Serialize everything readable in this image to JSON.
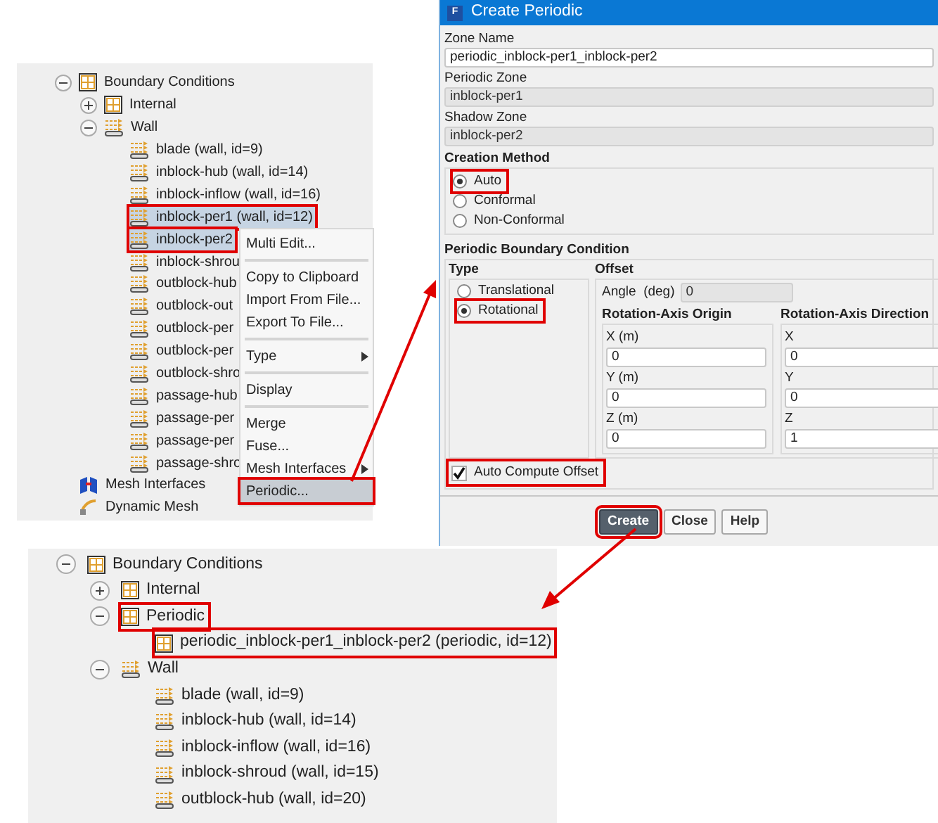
{
  "top_tree": {
    "items": [
      {
        "label": "Boundary Conditions",
        "kind": "grid",
        "expanded": true,
        "children": [
          {
            "label": "Internal",
            "kind": "grid",
            "expanded": false
          },
          {
            "label": "Wall",
            "kind": "wall",
            "expanded": true,
            "children": [
              {
                "label": "blade (wall, id=9)",
                "kind": "wall",
                "selected": false,
                "highlighted": false
              },
              {
                "label": "inblock-hub (wall, id=14)",
                "kind": "wall",
                "selected": false,
                "highlighted": false
              },
              {
                "label": "inblock-inflow (wall, id=16)",
                "kind": "wall",
                "selected": false,
                "highlighted": false
              },
              {
                "label": "inblock-per1 (wall, id=12)",
                "kind": "wall",
                "selected": true,
                "highlighted": true
              },
              {
                "label": "inblock-per2",
                "kind": "wall",
                "selected": true,
                "highlighted": true
              },
              {
                "label": "inblock-shrou",
                "kind": "wall",
                "selected": false,
                "highlighted": false
              },
              {
                "label": "outblock-hub",
                "kind": "wall",
                "selected": false,
                "highlighted": false
              },
              {
                "label": "outblock-out",
                "kind": "wall",
                "selected": false,
                "highlighted": false
              },
              {
                "label": "outblock-per",
                "kind": "wall",
                "selected": false,
                "highlighted": false
              },
              {
                "label": "outblock-per",
                "kind": "wall",
                "selected": false,
                "highlighted": false
              },
              {
                "label": "outblock-shro",
                "kind": "wall",
                "selected": false,
                "highlighted": false
              },
              {
                "label": "passage-hub",
                "kind": "wall",
                "selected": false,
                "highlighted": false
              },
              {
                "label": "passage-per",
                "kind": "wall",
                "selected": false,
                "highlighted": false
              },
              {
                "label": "passage-per",
                "kind": "wall",
                "selected": false,
                "highlighted": false
              },
              {
                "label": "passage-shro",
                "kind": "wall",
                "selected": false,
                "highlighted": false
              }
            ]
          }
        ]
      },
      {
        "label": "Mesh Interfaces",
        "kind": "interface"
      },
      {
        "label": "Dynamic Mesh",
        "kind": "dynamic"
      }
    ]
  },
  "context_menu": {
    "groups": [
      [
        {
          "label": "Multi Edit...",
          "submenu": false,
          "selected": false,
          "highlighted": false
        }
      ],
      [
        {
          "label": "Copy to Clipboard",
          "submenu": false,
          "selected": false,
          "highlighted": false
        },
        {
          "label": "Import From File...",
          "submenu": false,
          "selected": false,
          "highlighted": false
        },
        {
          "label": "Export To File...",
          "submenu": false,
          "selected": false,
          "highlighted": false
        }
      ],
      [
        {
          "label": "Type",
          "submenu": true,
          "selected": false,
          "highlighted": false
        }
      ],
      [
        {
          "label": "Display",
          "submenu": false,
          "selected": false,
          "highlighted": false
        }
      ],
      [
        {
          "label": "Merge",
          "submenu": false,
          "selected": false,
          "highlighted": false
        },
        {
          "label": "Fuse...",
          "submenu": false,
          "selected": false,
          "highlighted": false
        },
        {
          "label": "Mesh Interfaces",
          "submenu": true,
          "selected": false,
          "highlighted": false
        },
        {
          "label": "Periodic...",
          "submenu": false,
          "selected": true,
          "highlighted": true
        }
      ]
    ]
  },
  "dialog": {
    "title_icon": "F",
    "title": "Create Periodic",
    "fields": [
      {
        "label": "Zone Name",
        "value": "periodic_inblock-per1_inblock-per2",
        "disabled": false
      },
      {
        "label": "Periodic Zone",
        "value": "inblock-per1",
        "disabled": true
      },
      {
        "label": "Shadow Zone",
        "value": "inblock-per2",
        "disabled": true
      }
    ],
    "creation_method": {
      "label": "Creation Method",
      "options": [
        {
          "label": "Auto",
          "selected": true,
          "highlighted": true
        },
        {
          "label": "Conformal",
          "selected": false,
          "highlighted": false
        },
        {
          "label": "Non-Conformal",
          "selected": false,
          "highlighted": false
        }
      ]
    },
    "periodic_boundary_condition": {
      "label": "Periodic Boundary Condition",
      "type": {
        "label": "Type",
        "options": [
          {
            "label": "Translational",
            "selected": false,
            "highlighted": false
          },
          {
            "label": "Rotational",
            "selected": true,
            "highlighted": true
          }
        ]
      },
      "offset": {
        "label": "Offset",
        "angle": {
          "label": "Angle  (deg)",
          "value": "0",
          "disabled": true
        },
        "axis_groups": [
          {
            "label": "Rotation-Axis Origin",
            "fields": [
              {
                "label": "X (m)",
                "value": "0"
              },
              {
                "label": "Y (m)",
                "value": "0"
              },
              {
                "label": "Z (m)",
                "value": "0"
              }
            ]
          },
          {
            "label": "Rotation-Axis Direction",
            "fields": [
              {
                "label": "X",
                "value": "0"
              },
              {
                "label": "Y",
                "value": "0"
              },
              {
                "label": "Z",
                "value": "1"
              }
            ]
          }
        ]
      },
      "auto_compute_offset": {
        "label": "Auto Compute Offset",
        "checked": true,
        "highlighted": true
      }
    },
    "buttons": [
      {
        "label": "Create",
        "kind": "primary",
        "highlighted": true
      },
      {
        "label": "Close",
        "kind": "normal",
        "highlighted": false
      },
      {
        "label": "Help",
        "kind": "normal",
        "highlighted": false
      }
    ]
  },
  "bottom_tree": {
    "items": [
      {
        "label": "Boundary Conditions",
        "kind": "grid",
        "expanded": true,
        "children": [
          {
            "label": "Internal",
            "kind": "grid",
            "expanded": false,
            "highlighted": false
          },
          {
            "label": "Periodic",
            "kind": "grid",
            "expanded": true,
            "highlighted": true,
            "children": [
              {
                "label": "periodic_inblock-per1_inblock-per2 (periodic, id=12)",
                "kind": "grid",
                "selected": false,
                "highlighted": true
              }
            ]
          },
          {
            "label": "Wall",
            "kind": "wall",
            "expanded": true,
            "highlighted": false,
            "children": [
              {
                "label": "blade (wall, id=9)",
                "kind": "wall",
                "selected": false,
                "highlighted": false
              },
              {
                "label": "inblock-hub (wall, id=14)",
                "kind": "wall",
                "selected": false,
                "highlighted": false
              },
              {
                "label": "inblock-inflow (wall, id=16)",
                "kind": "wall",
                "selected": false,
                "highlighted": false
              },
              {
                "label": "inblock-shroud (wall, id=15)",
                "kind": "wall",
                "selected": false,
                "highlighted": false
              },
              {
                "label": "outblock-hub (wall, id=20)",
                "kind": "wall",
                "selected": false,
                "highlighted": false
              }
            ]
          }
        ]
      }
    ]
  }
}
